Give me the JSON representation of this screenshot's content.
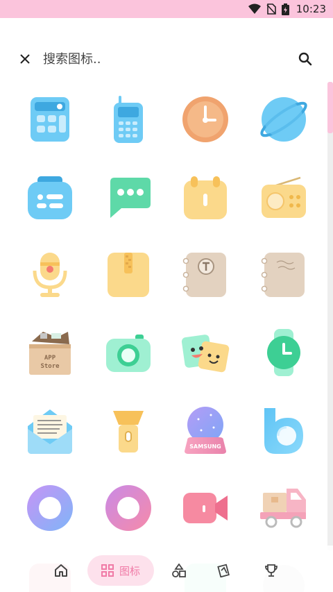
{
  "status_bar": {
    "time": "10:23",
    "icons": [
      "wifi-icon",
      "no-sim-icon",
      "battery-charging-icon"
    ],
    "background": "#fbc4dc"
  },
  "search": {
    "placeholder": "搜索图标..",
    "value": ""
  },
  "icon_grid": {
    "icons": [
      "calculator-icon",
      "phone-icon",
      "clock-icon",
      "browser-icon",
      "contacts-icon",
      "messages-icon",
      "calendar-icon",
      "radio-icon",
      "microphone-icon",
      "notes-icon",
      "contacts-book-icon",
      "notebook-icon",
      "app-store-icon",
      "camera-icon",
      "stickers-icon",
      "smartwatch-icon",
      "mail-icon",
      "flashlight-icon",
      "samsung-globe-icon",
      "bixby-icon",
      "ring-blue-icon",
      "ring-pink-icon",
      "video-camera-icon",
      "delivery-truck-icon"
    ],
    "samsung_label": "SAMSUNG",
    "app_store_label_1": "APP",
    "app_store_label_2": "Store"
  },
  "bottom_nav": {
    "items": [
      {
        "icon": "home-icon"
      },
      {
        "icon": "grid-icon",
        "label": "图标",
        "active": true
      },
      {
        "icon": "shapes-icon"
      },
      {
        "icon": "wallpaper-icon"
      },
      {
        "icon": "trophy-icon"
      }
    ],
    "active_color": "#f07aa6"
  },
  "colors": {
    "accent_pink": "#fbc4dc",
    "icon_blue": "#6ecbf5",
    "icon_yellow": "#fbd98b",
    "icon_green": "#83e3c0",
    "icon_tan": "#e3d2c0"
  }
}
